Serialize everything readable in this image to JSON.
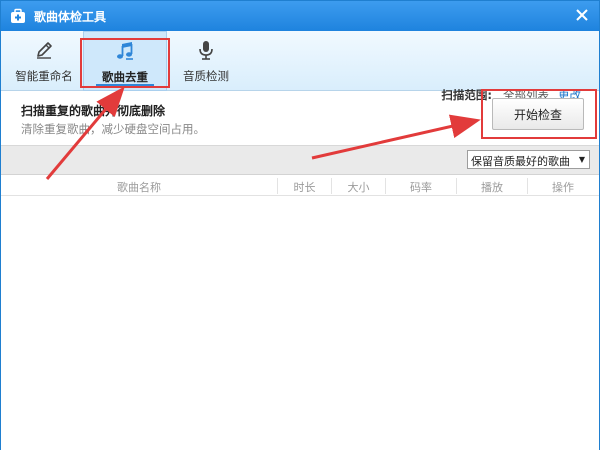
{
  "window": {
    "title": "歌曲体检工具"
  },
  "tabs": [
    {
      "label": "智能重命名",
      "icon": "pencil-icon"
    },
    {
      "label": "歌曲去重",
      "icon": "music-note-icon",
      "active": true
    },
    {
      "label": "音质检测",
      "icon": "microphone-icon"
    }
  ],
  "scan": {
    "label": "扫描范围:",
    "value": "全部列表",
    "change_link": "更改"
  },
  "main": {
    "heading": "扫描重复的歌曲并彻底删除",
    "subheading": "清除重复歌曲，减少硬盘空间占用。",
    "start_button": "开始检查"
  },
  "filter": {
    "selected": "保留音质最好的歌曲"
  },
  "table": {
    "columns": [
      "歌曲名称",
      "时长",
      "大小",
      "码率",
      "播放",
      "操作"
    ],
    "rows": []
  },
  "colors": {
    "titlebar": "#1e83de",
    "accent": "#2f86d8",
    "annotation_red": "#e23b3b",
    "link": "#1a73c9"
  }
}
